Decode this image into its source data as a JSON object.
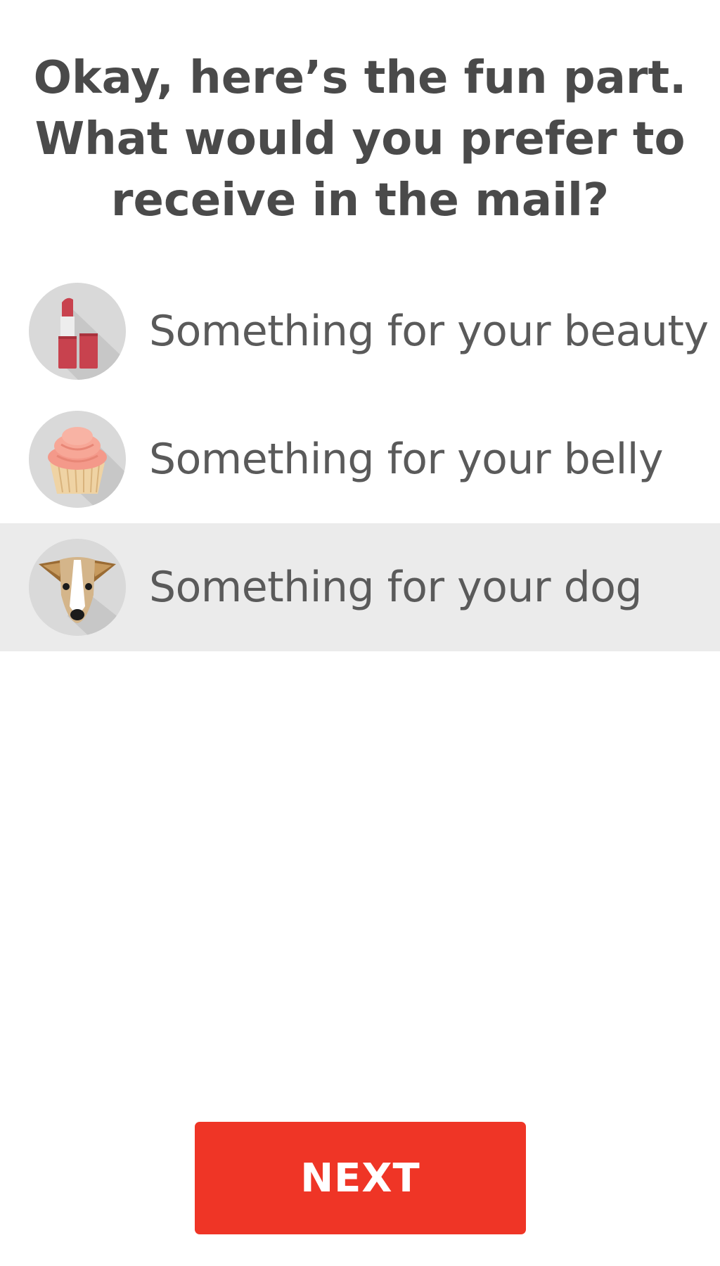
{
  "question": {
    "lines": [
      "Okay, here’s the fun part.",
      "What would you prefer to",
      "receive in the mail?"
    ]
  },
  "options": [
    {
      "label": "Something for your beauty",
      "icon": "lipstick-icon",
      "selected": false
    },
    {
      "label": "Something for your belly",
      "icon": "cupcake-icon",
      "selected": false
    },
    {
      "label": "Something for your dog",
      "icon": "dog-icon",
      "selected": true
    }
  ],
  "next_button": {
    "label": "NEXT"
  },
  "colors": {
    "accent": "#ef3526",
    "title_text": "#4a4a4a",
    "option_text": "#5a5a5a",
    "selected_row_bg": "#ebebeb",
    "icon_circle_bg": "#d9d9d9"
  }
}
